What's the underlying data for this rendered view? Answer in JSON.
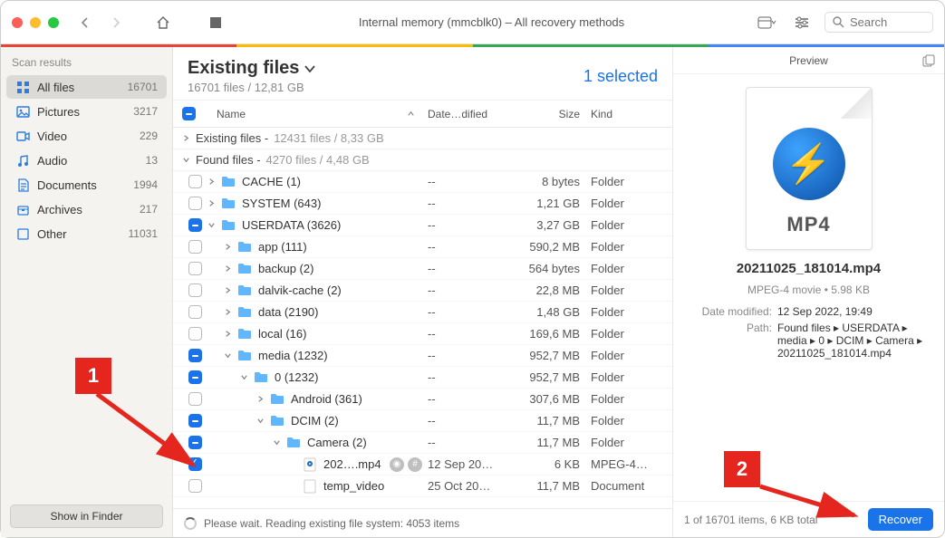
{
  "window": {
    "title": "Internal memory (mmcblk0) – All recovery methods",
    "search_placeholder": "Search"
  },
  "colorbar": [
    "#e94335",
    "#fabb05",
    "#34a853",
    "#4285f4"
  ],
  "sidebar": {
    "header": "Scan results",
    "items": [
      {
        "icon": "grid",
        "label": "All files",
        "count": "16701",
        "active": true
      },
      {
        "icon": "image",
        "label": "Pictures",
        "count": "3217"
      },
      {
        "icon": "video",
        "label": "Video",
        "count": "229"
      },
      {
        "icon": "audio",
        "label": "Audio",
        "count": "13"
      },
      {
        "icon": "doc",
        "label": "Documents",
        "count": "1994"
      },
      {
        "icon": "archive",
        "label": "Archives",
        "count": "217"
      },
      {
        "icon": "other",
        "label": "Other",
        "count": "11031"
      }
    ],
    "footer_button": "Show in Finder"
  },
  "center": {
    "title": "Existing files",
    "subtitle": "16701 files / 12,81 GB",
    "selected_text": "1 selected",
    "columns": {
      "name": "Name",
      "date": "Date…dified",
      "size": "Size",
      "kind": "Kind"
    },
    "sections": [
      {
        "caret": "right",
        "name": "Existing files",
        "info": "12431 files / 8,33 GB"
      },
      {
        "caret": "down",
        "name": "Found files",
        "info": "4270 files / 4,48 GB"
      }
    ],
    "rows": [
      {
        "indent": 0,
        "check": "empty",
        "caret": "right",
        "icon": "folder",
        "name": "CACHE (1)",
        "date": "--",
        "size": "8 bytes",
        "kind": "Folder"
      },
      {
        "indent": 0,
        "check": "empty",
        "caret": "right",
        "icon": "folder",
        "name": "SYSTEM (643)",
        "date": "--",
        "size": "1,21 GB",
        "kind": "Folder"
      },
      {
        "indent": 0,
        "check": "mixed",
        "caret": "down",
        "icon": "folder",
        "name": "USERDATA (3626)",
        "date": "--",
        "size": "3,27 GB",
        "kind": "Folder"
      },
      {
        "indent": 1,
        "check": "empty",
        "caret": "right",
        "icon": "folder",
        "name": "app (111)",
        "date": "--",
        "size": "590,2 MB",
        "kind": "Folder"
      },
      {
        "indent": 1,
        "check": "empty",
        "caret": "right",
        "icon": "folder",
        "name": "backup (2)",
        "date": "--",
        "size": "564 bytes",
        "kind": "Folder"
      },
      {
        "indent": 1,
        "check": "empty",
        "caret": "right",
        "icon": "folder",
        "name": "dalvik-cache (2)",
        "date": "--",
        "size": "22,8 MB",
        "kind": "Folder"
      },
      {
        "indent": 1,
        "check": "empty",
        "caret": "right",
        "icon": "folder",
        "name": "data (2190)",
        "date": "--",
        "size": "1,48 GB",
        "kind": "Folder"
      },
      {
        "indent": 1,
        "check": "empty",
        "caret": "right",
        "icon": "folder",
        "name": "local (16)",
        "date": "--",
        "size": "169,6 MB",
        "kind": "Folder"
      },
      {
        "indent": 1,
        "check": "mixed",
        "caret": "down",
        "icon": "folder",
        "name": "media (1232)",
        "date": "--",
        "size": "952,7 MB",
        "kind": "Folder"
      },
      {
        "indent": 2,
        "check": "mixed",
        "caret": "down",
        "icon": "folder",
        "name": "0 (1232)",
        "date": "--",
        "size": "952,7 MB",
        "kind": "Folder"
      },
      {
        "indent": 3,
        "check": "empty",
        "caret": "right",
        "icon": "folder",
        "name": "Android (361)",
        "date": "--",
        "size": "307,6 MB",
        "kind": "Folder"
      },
      {
        "indent": 3,
        "check": "mixed",
        "caret": "down",
        "icon": "folder",
        "name": "DCIM (2)",
        "date": "--",
        "size": "11,7 MB",
        "kind": "Folder"
      },
      {
        "indent": 4,
        "check": "mixed",
        "caret": "down",
        "icon": "folder",
        "name": "Camera (2)",
        "date": "--",
        "size": "11,7 MB",
        "kind": "Folder"
      },
      {
        "indent": 5,
        "check": "checked",
        "caret": "",
        "icon": "file-mp4",
        "name": "202….mp4",
        "date": "12 Sep 20…",
        "size": "6 KB",
        "kind": "MPEG-4…",
        "badges": true
      },
      {
        "indent": 5,
        "check": "empty",
        "caret": "",
        "icon": "file",
        "name": "temp_video",
        "date": "25 Oct 20…",
        "size": "11,7 MB",
        "kind": "Document"
      }
    ],
    "footer_status": "Please wait. Reading existing file system: 4053 items"
  },
  "preview": {
    "header": "Preview",
    "thumb_ext": "MP4",
    "filename": "20211025_181014.mp4",
    "meta_line": "MPEG-4 movie • 5.98 KB",
    "props": [
      {
        "k": "Date modified:",
        "v": "12 Sep 2022, 19:49"
      },
      {
        "k": "Path:",
        "v": "Found files ▸ USERDATA ▸ media ▸ 0 ▸ DCIM ▸ Camera ▸ 20211025_181014.mp4"
      }
    ],
    "footer_summary": "1 of 16701 items, 6 KB total",
    "recover_label": "Recover"
  },
  "annotations": {
    "a1": "1",
    "a2": "2"
  }
}
